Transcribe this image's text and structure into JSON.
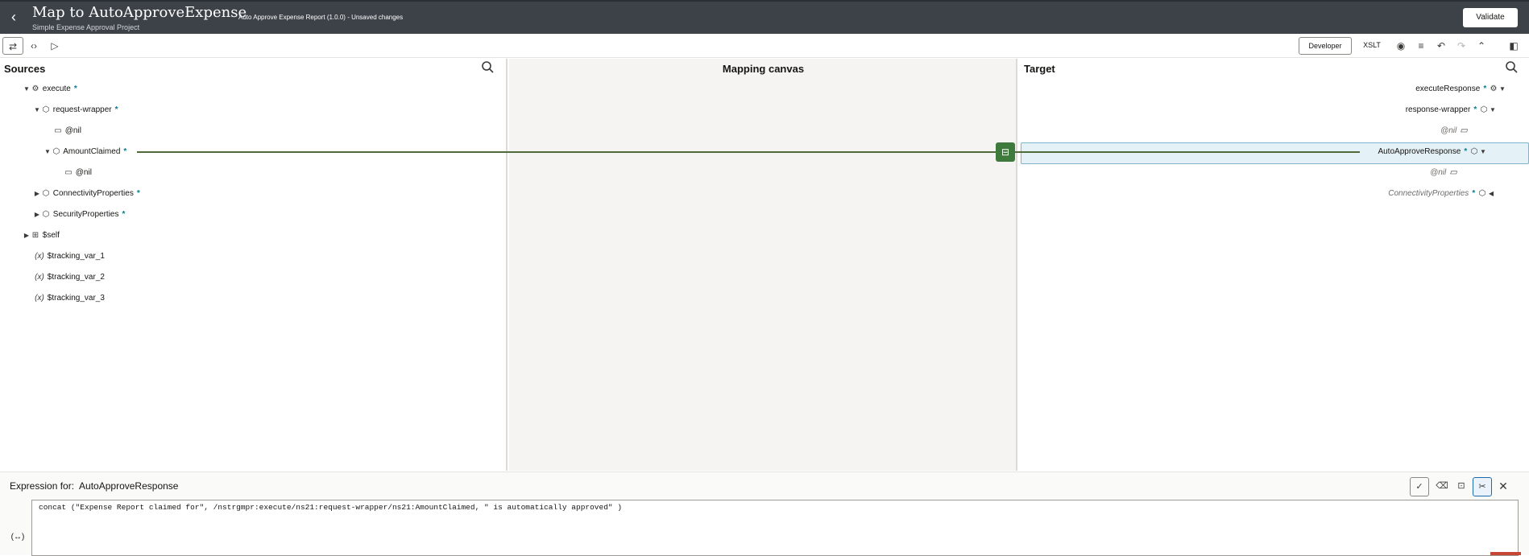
{
  "header": {
    "title": "Map to AutoApproveExpense",
    "subtitle": "Simple Expense Approval Project",
    "status": "Auto Approve Expense Report (1.0.0) - Unsaved changes",
    "validate_label": "Validate"
  },
  "toolbar": {
    "developer_label": "Developer",
    "xslt_label": "XSLT"
  },
  "sources": {
    "title": "Sources",
    "nodes": [
      {
        "label": "execute",
        "required": "*"
      },
      {
        "label": "request-wrapper",
        "required": "*"
      },
      {
        "label": "@nil"
      },
      {
        "label": "AmountClaimed",
        "required": "*"
      },
      {
        "label": "@nil"
      },
      {
        "label": "ConnectivityProperties",
        "required": "*"
      },
      {
        "label": "SecurityProperties",
        "required": "*"
      },
      {
        "label": "$self"
      },
      {
        "label": "$tracking_var_1"
      },
      {
        "label": "$tracking_var_2"
      },
      {
        "label": "$tracking_var_3"
      }
    ]
  },
  "canvas": {
    "title": "Mapping canvas"
  },
  "target": {
    "title": "Target",
    "nodes": [
      {
        "label": "executeResponse",
        "required": "*"
      },
      {
        "label": "response-wrapper",
        "required": "*"
      },
      {
        "label": "@nil"
      },
      {
        "label": "AutoApproveResponse",
        "required": "*"
      },
      {
        "label": "@nil"
      },
      {
        "label": "ConnectivityProperties",
        "required": "*"
      }
    ]
  },
  "expression": {
    "label": "Expression for:",
    "target_name": "AutoApproveResponse",
    "value": "concat (\"Expense Report claimed for\", /nstrgmpr:execute/ns21:request-wrapper/ns21:AmountClaimed, \" is automatically approved\" )",
    "fx_label": "(↔)"
  },
  "colors": {
    "header_bg": "#3d4249",
    "mapping_line": "#4e6b39",
    "function_node": "#3f7a3d",
    "required_marker": "#0d7c91",
    "selected_row": "#e4f1f6"
  }
}
